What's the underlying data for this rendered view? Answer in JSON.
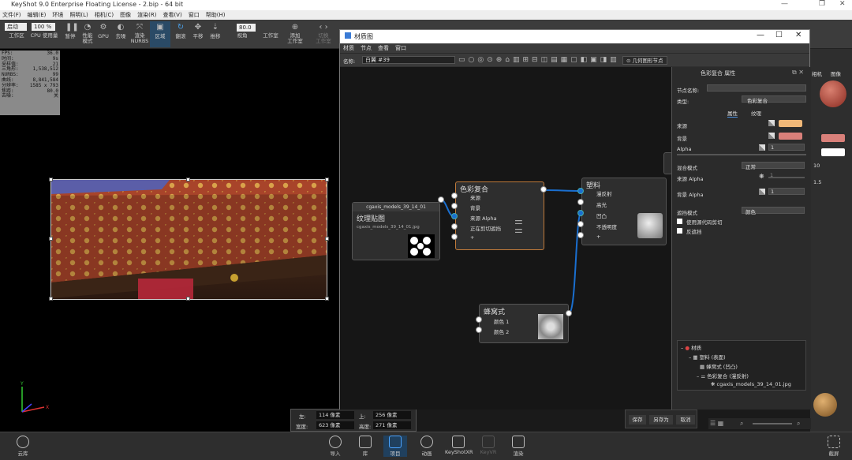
{
  "window": {
    "title": "KeyShot 9.0 Enterprise Floating License  -  2.bip  -  64 bit"
  },
  "menu": [
    "文件(F)",
    "编辑(E)",
    "环境",
    "照明(L)",
    "相机(C)",
    "图像",
    "渲染(R)",
    "查看(V)",
    "窗口",
    "帮助(H)"
  ],
  "toolbar": {
    "import_select": "启动",
    "zoom_select": "100 %",
    "items": [
      "工作区",
      "CPU 使用量",
      "暂停",
      "性能\n模式",
      "GPU",
      "去噪",
      "渲染\nNURBS",
      "区域",
      "翻滚",
      "平移",
      "推移",
      "视角",
      "工作室",
      "添加\n工作室",
      "切换\n工作室"
    ],
    "fov_value": "80.0"
  },
  "stats": [
    [
      "FPS:",
      "36.0"
    ],
    [
      "时间:",
      "9s"
    ],
    [
      "采样值:",
      "21"
    ],
    [
      "三角形:",
      "1,538,512"
    ],
    [
      "NURBS:",
      "99"
    ],
    [
      "曲线:",
      "8,841,584"
    ],
    [
      "分辨率:",
      "1585 x 793"
    ],
    [
      "焦距:",
      "80.0"
    ],
    [
      "去噪:",
      "关"
    ]
  ],
  "geometry": {
    "left_label": "左:",
    "left_value": "114 像素",
    "top_label": "上:",
    "top_value": "256 像素",
    "width_label": "宽度:",
    "width_value": "623 像素",
    "height_label": "高度:",
    "height_value": "271 像素"
  },
  "bottom": {
    "items": [
      "导入",
      "库",
      "项目",
      "动画",
      "KeyShotXR",
      "KeyVR",
      "渲染"
    ],
    "left": "云库",
    "right": "截屏"
  },
  "material_window": {
    "title": "材质图",
    "menu": [
      "材质",
      "节点",
      "查看",
      "窗口"
    ],
    "name_label": "名称:",
    "name_value": "白翼 #39",
    "geo_node_button": "几何图形节点",
    "nodes": {
      "texture": {
        "header": "cgaxis_models_39_14_01",
        "title": "纹理贴图",
        "file": "cgaxis_models_39_14_01.jpg"
      },
      "colorcomp": {
        "title": "色彩复合",
        "ports": [
          "来源",
          "背景",
          "来源 Alpha",
          "正在剪切遮挡",
          "+"
        ]
      },
      "plastic": {
        "title": "塑料",
        "ports": [
          "漫反射",
          "高光",
          "凹凸",
          "不透明度",
          "+"
        ]
      },
      "cellular": {
        "title": "蜂窝式",
        "ports": [
          "颜色 1",
          "颜色 2"
        ]
      }
    },
    "props": {
      "panel_title": "色彩复合 属性",
      "node_name_label": "节点名称:",
      "type_label": "类型:",
      "type_value": "色彩复合",
      "tabs": [
        "属性",
        "纹理"
      ],
      "source_label": "来源",
      "bg_label": "背景",
      "alpha_label": "Alpha",
      "alpha_value": "1",
      "blend_label": "混合模式",
      "blend_value": "正常",
      "source_alpha_label": "来源 Alpha",
      "source_alpha_value": "1",
      "bg_alpha_label": "背景 Alpha",
      "bg_alpha_value": "1",
      "mask_label": "遮挡模式",
      "mask_value": "颜色",
      "check1": "使用源代码剪切",
      "check2": "反遮挡",
      "source_color": "#f0b878",
      "bg_color": "#d9807a"
    },
    "tree": [
      "材质",
      "塑料 (表面)",
      "蜂窝式 (凹凸)",
      "色彩复合 (漫反射)",
      "cgaxis_models_39_14_01.jpg"
    ],
    "buttons": [
      "保存",
      "另存为",
      "取消"
    ]
  },
  "right": {
    "labels": [
      "相机",
      "图像"
    ],
    "values": [
      "10",
      "1.5"
    ]
  }
}
